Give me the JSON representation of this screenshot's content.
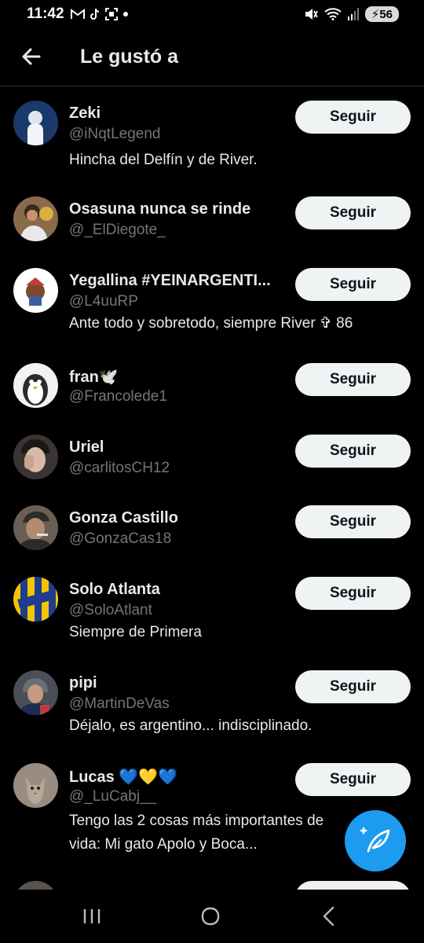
{
  "status_bar": {
    "time": "11:42",
    "battery": "56"
  },
  "header": {
    "title": "Le gustó a"
  },
  "users": [
    {
      "name": "Zeki",
      "handle": "@iNqtLegend",
      "bio": "Hincha del Delfín y de River.",
      "button": "Seguir"
    },
    {
      "name": "Osasuna nunca se rinde",
      "handle": "@_ElDiegote_",
      "bio": "",
      "button": "Seguir"
    },
    {
      "name": "Yegallina #YEINARGENTI...",
      "handle": "@L4uuRP",
      "bio": "Ante todo y sobretodo, siempre River ✞ 86",
      "button": "Seguir"
    },
    {
      "name": "fran🕊️",
      "handle": "@Francolede1",
      "bio": "",
      "button": "Seguir"
    },
    {
      "name": "Uriel",
      "handle": "@carlitosCH12",
      "bio": "",
      "button": "Seguir"
    },
    {
      "name": "Gonza Castillo",
      "handle": "@GonzaCas18",
      "bio": "",
      "button": "Seguir"
    },
    {
      "name": "Solo Atlanta",
      "handle": "@SoloAtlant",
      "bio": "Siempre de Primera",
      "button": "Seguir"
    },
    {
      "name": "pipi",
      "handle": "@MartinDeVas",
      "bio": "Déjalo, es argentino... indisciplinado.",
      "button": "Seguir"
    },
    {
      "name": "Lucas 💙💛💙",
      "handle": "@_LuCabj__",
      "bio": "Tengo las 2 cosas más importantes de vida: Mi gato Apolo y Boca...",
      "button": "Seguir"
    }
  ],
  "colors": {
    "background": "#000000",
    "primary_text": "#e7e9ea",
    "secondary_text": "#71767b",
    "follow_button_bg": "#eff3f4",
    "accent": "#1d9bf0"
  },
  "icons": {
    "back": "arrow-left-icon",
    "fab": "compose-feather-icon",
    "nav_recent": "recent-apps-icon",
    "nav_home": "home-circle-icon",
    "nav_back": "chevron-left-icon"
  }
}
